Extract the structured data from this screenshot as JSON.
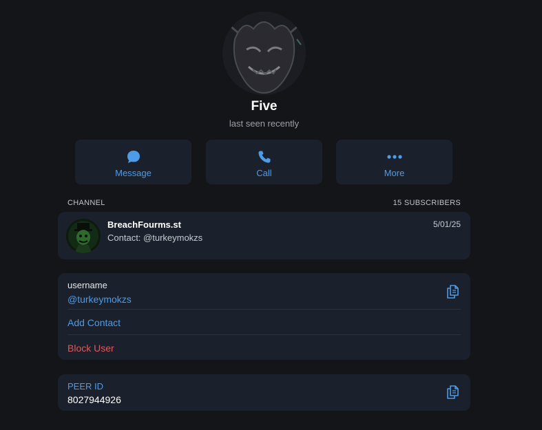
{
  "profile": {
    "name": "Five",
    "status": "last seen recently"
  },
  "actions": {
    "message_label": "Message",
    "call_label": "Call",
    "more_label": "More"
  },
  "channel_section": {
    "header": "CHANNEL",
    "subscribers": "15 SUBSCRIBERS",
    "channel": {
      "name": "BreachFourms.st",
      "description": "Contact: @turkeymokzs",
      "date": "5/01/25"
    }
  },
  "info": {
    "username_label": "username",
    "username_value": "@turkeymokzs",
    "add_contact": "Add Contact",
    "block_user": "Block User"
  },
  "peer": {
    "label": "PEER ID",
    "value": "8027944926"
  },
  "colors": {
    "accent": "#4e9be8",
    "danger": "#e0585a",
    "card": "#1b212c",
    "background": "#141518"
  }
}
